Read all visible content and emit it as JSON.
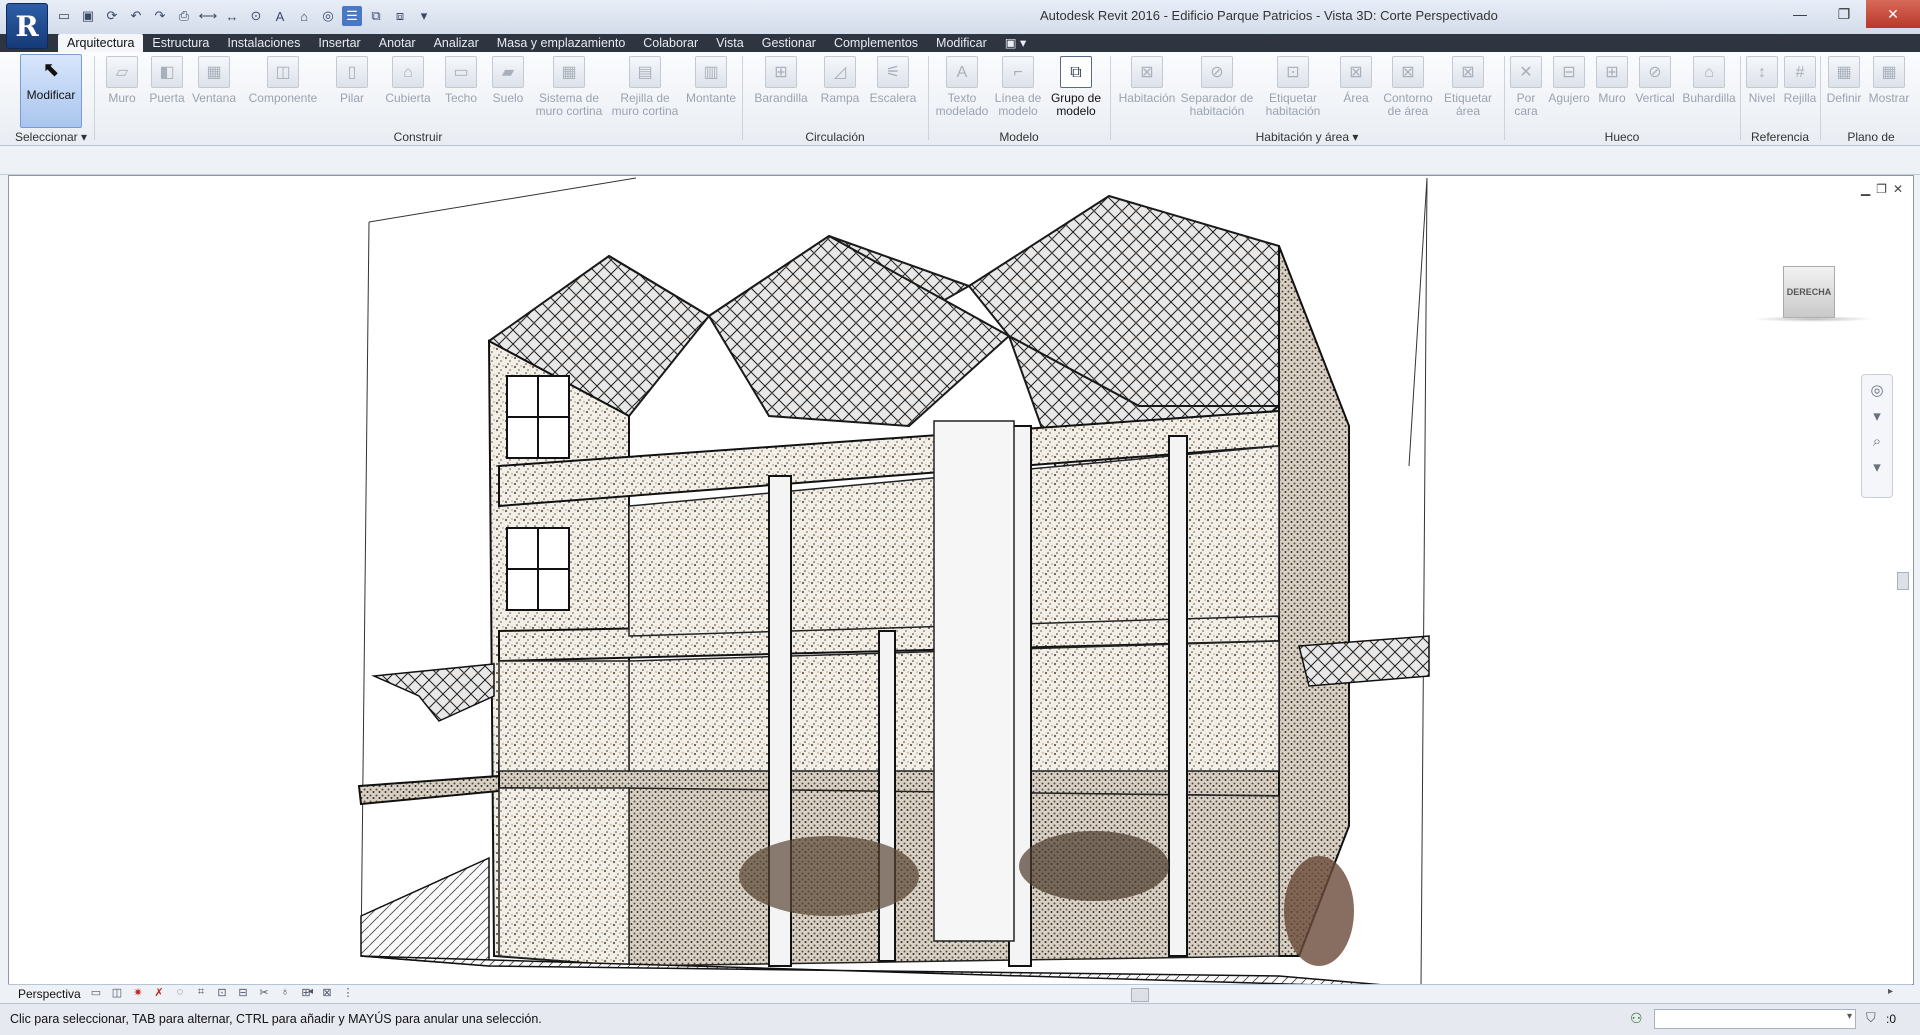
{
  "window": {
    "title": "Autodesk Revit 2016 -    Edificio Parque Patricios - Vista 3D: Corte Perspectivado",
    "app_button_letter": "R",
    "controls": [
      "minimize-icon",
      "maximize-icon",
      "close-icon"
    ]
  },
  "quick_access": {
    "icons": [
      "open-icon",
      "save-icon",
      "sync-icon",
      "undo-icon",
      "redo-icon",
      "print-icon",
      "measure-icon",
      "dimension-icon",
      "tag-icon",
      "text-icon",
      "3d-view-icon",
      "section-icon",
      "thin-lines-icon",
      "close-hidden-icon",
      "switch-windows-icon",
      "customize-icon"
    ]
  },
  "tabs": [
    {
      "label": "Arquitectura",
      "active": true
    },
    {
      "label": "Estructura"
    },
    {
      "label": "Instalaciones"
    },
    {
      "label": "Insertar"
    },
    {
      "label": "Anotar"
    },
    {
      "label": "Analizar"
    },
    {
      "label": "Masa y emplazamiento"
    },
    {
      "label": "Colaborar"
    },
    {
      "label": "Vista"
    },
    {
      "label": "Gestionar"
    },
    {
      "label": "Complementos"
    },
    {
      "label": "Modificar"
    }
  ],
  "ribbon": {
    "buttons": [
      {
        "label": "Modificar",
        "icon": "cursor-icon"
      },
      {
        "label": "Muro",
        "icon": "wall-icon"
      },
      {
        "label": "Puerta",
        "icon": "door-icon"
      },
      {
        "label": "Ventana",
        "icon": "window-icon"
      },
      {
        "label": "Componente",
        "icon": "component-icon"
      },
      {
        "label": "Pilar",
        "icon": "column-icon"
      },
      {
        "label": "Cubierta",
        "icon": "roof-icon"
      },
      {
        "label": "Techo",
        "icon": "ceiling-icon"
      },
      {
        "label": "Suelo",
        "icon": "floor-icon"
      },
      {
        "label": "Sistema de muro cortina",
        "icon": "curtain-system-icon"
      },
      {
        "label": "Rejilla de muro cortina",
        "icon": "curtain-grid-icon"
      },
      {
        "label": "Montante",
        "icon": "mullion-icon"
      },
      {
        "label": "Barandilla",
        "icon": "railing-icon"
      },
      {
        "label": "Rampa",
        "icon": "ramp-icon"
      },
      {
        "label": "Escalera",
        "icon": "stair-icon"
      },
      {
        "label": "Texto modelado",
        "icon": "model-text-icon"
      },
      {
        "label": "Línea de modelo",
        "icon": "model-line-icon"
      },
      {
        "label": "Grupo de modelo",
        "icon": "model-group-icon"
      },
      {
        "label": "Habitación",
        "icon": "room-icon"
      },
      {
        "label": "Separador de habitación",
        "icon": "room-separator-icon"
      },
      {
        "label": "Etiquetar habitación",
        "icon": "tag-room-icon"
      },
      {
        "label": "Área",
        "icon": "area-icon"
      },
      {
        "label": "Contorno de área",
        "icon": "area-boundary-icon"
      },
      {
        "label": "Etiquetar área",
        "icon": "tag-area-icon"
      },
      {
        "label": "Por cara",
        "icon": "by-face-icon"
      },
      {
        "label": "Agujero",
        "icon": "shaft-icon"
      },
      {
        "label": "Muro",
        "icon": "wall-opening-icon"
      },
      {
        "label": "Vertical",
        "icon": "vertical-opening-icon"
      },
      {
        "label": "Buhardilla",
        "icon": "dormer-icon"
      },
      {
        "label": "Nivel",
        "icon": "level-icon"
      },
      {
        "label": "Rejilla",
        "icon": "grid-icon"
      },
      {
        "label": "Definir",
        "icon": "set-workplane-icon"
      },
      {
        "label": "Mostrar",
        "icon": "show-workplane-icon"
      }
    ],
    "panels": [
      {
        "title": "Seleccionar ▾"
      },
      {
        "title": "Construir"
      },
      {
        "title": "Circulación"
      },
      {
        "title": "Modelo"
      },
      {
        "title": "Habitación y área ▾"
      },
      {
        "title": "Hueco"
      },
      {
        "title": "Referencia"
      },
      {
        "title": "Plano de"
      }
    ]
  },
  "viewport": {
    "viewcube_label": "DERECHA",
    "controls": [
      "minimize-view-icon",
      "restore-view-icon",
      "close-view-icon"
    ]
  },
  "view_bar": {
    "scale_label": "Perspectiva"
  },
  "status": {
    "message": "Clic para seleccionar, TAB para alternar, CTRL para añadir y MAYÚS para anular una selección.",
    "filter_count": ":0"
  }
}
